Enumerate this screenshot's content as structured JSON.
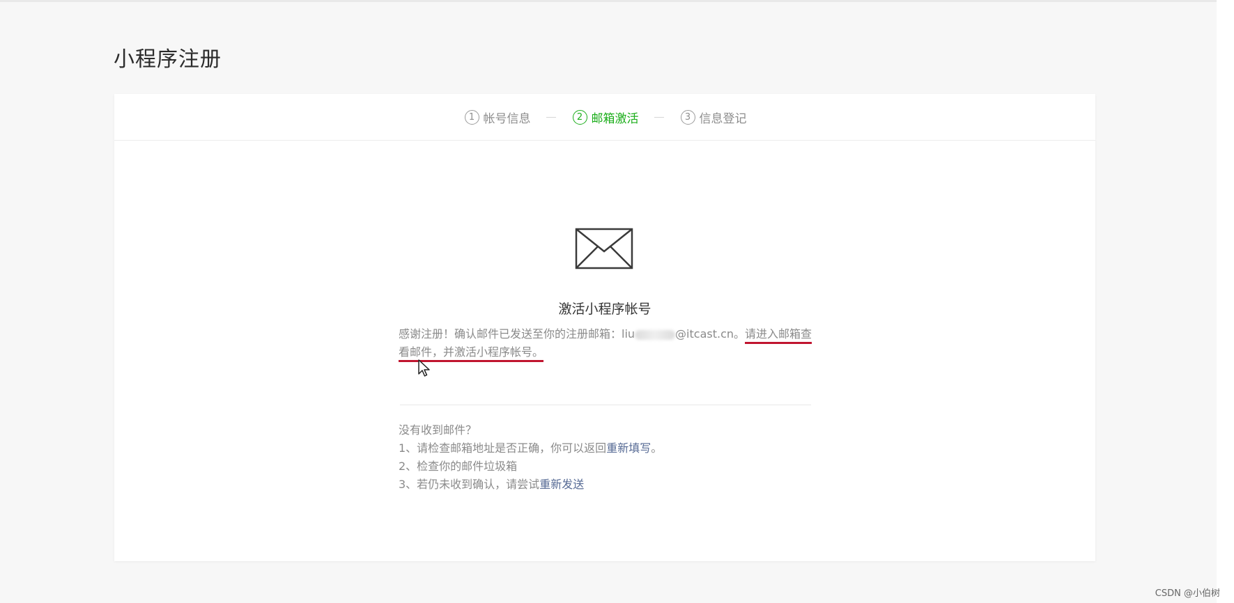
{
  "page": {
    "title": "小程序注册"
  },
  "steps": [
    {
      "num": "1",
      "label": "帐号信息",
      "active": false
    },
    {
      "num": "2",
      "label": "邮箱激活",
      "active": true
    },
    {
      "num": "3",
      "label": "信息登记",
      "active": false
    }
  ],
  "card": {
    "icon": "envelope-icon",
    "heading": "激活小程序帐号",
    "message_prefix": "感谢注册！确认邮件已发送至你的注册邮箱：",
    "email_start": "liu",
    "email_end": "@itcast.cn",
    "message_mid": "。",
    "message_highlight": "请进入邮箱查看邮件，并激活小程序帐号。"
  },
  "help": {
    "title": "没有收到邮件？",
    "item1_prefix": "1、请检查邮箱地址是否正确，你可以返回",
    "item1_link": "重新填写",
    "item1_suffix": "。",
    "item2": "2、检查你的邮件垃圾箱",
    "item3_prefix": "3、若仍未收到确认，请尝试",
    "item3_link": "重新发送"
  },
  "watermark": "CSDN @小伯树",
  "colors": {
    "accent": "#1aad19",
    "link": "#576b95",
    "highlight_underline": "#c0152f"
  }
}
